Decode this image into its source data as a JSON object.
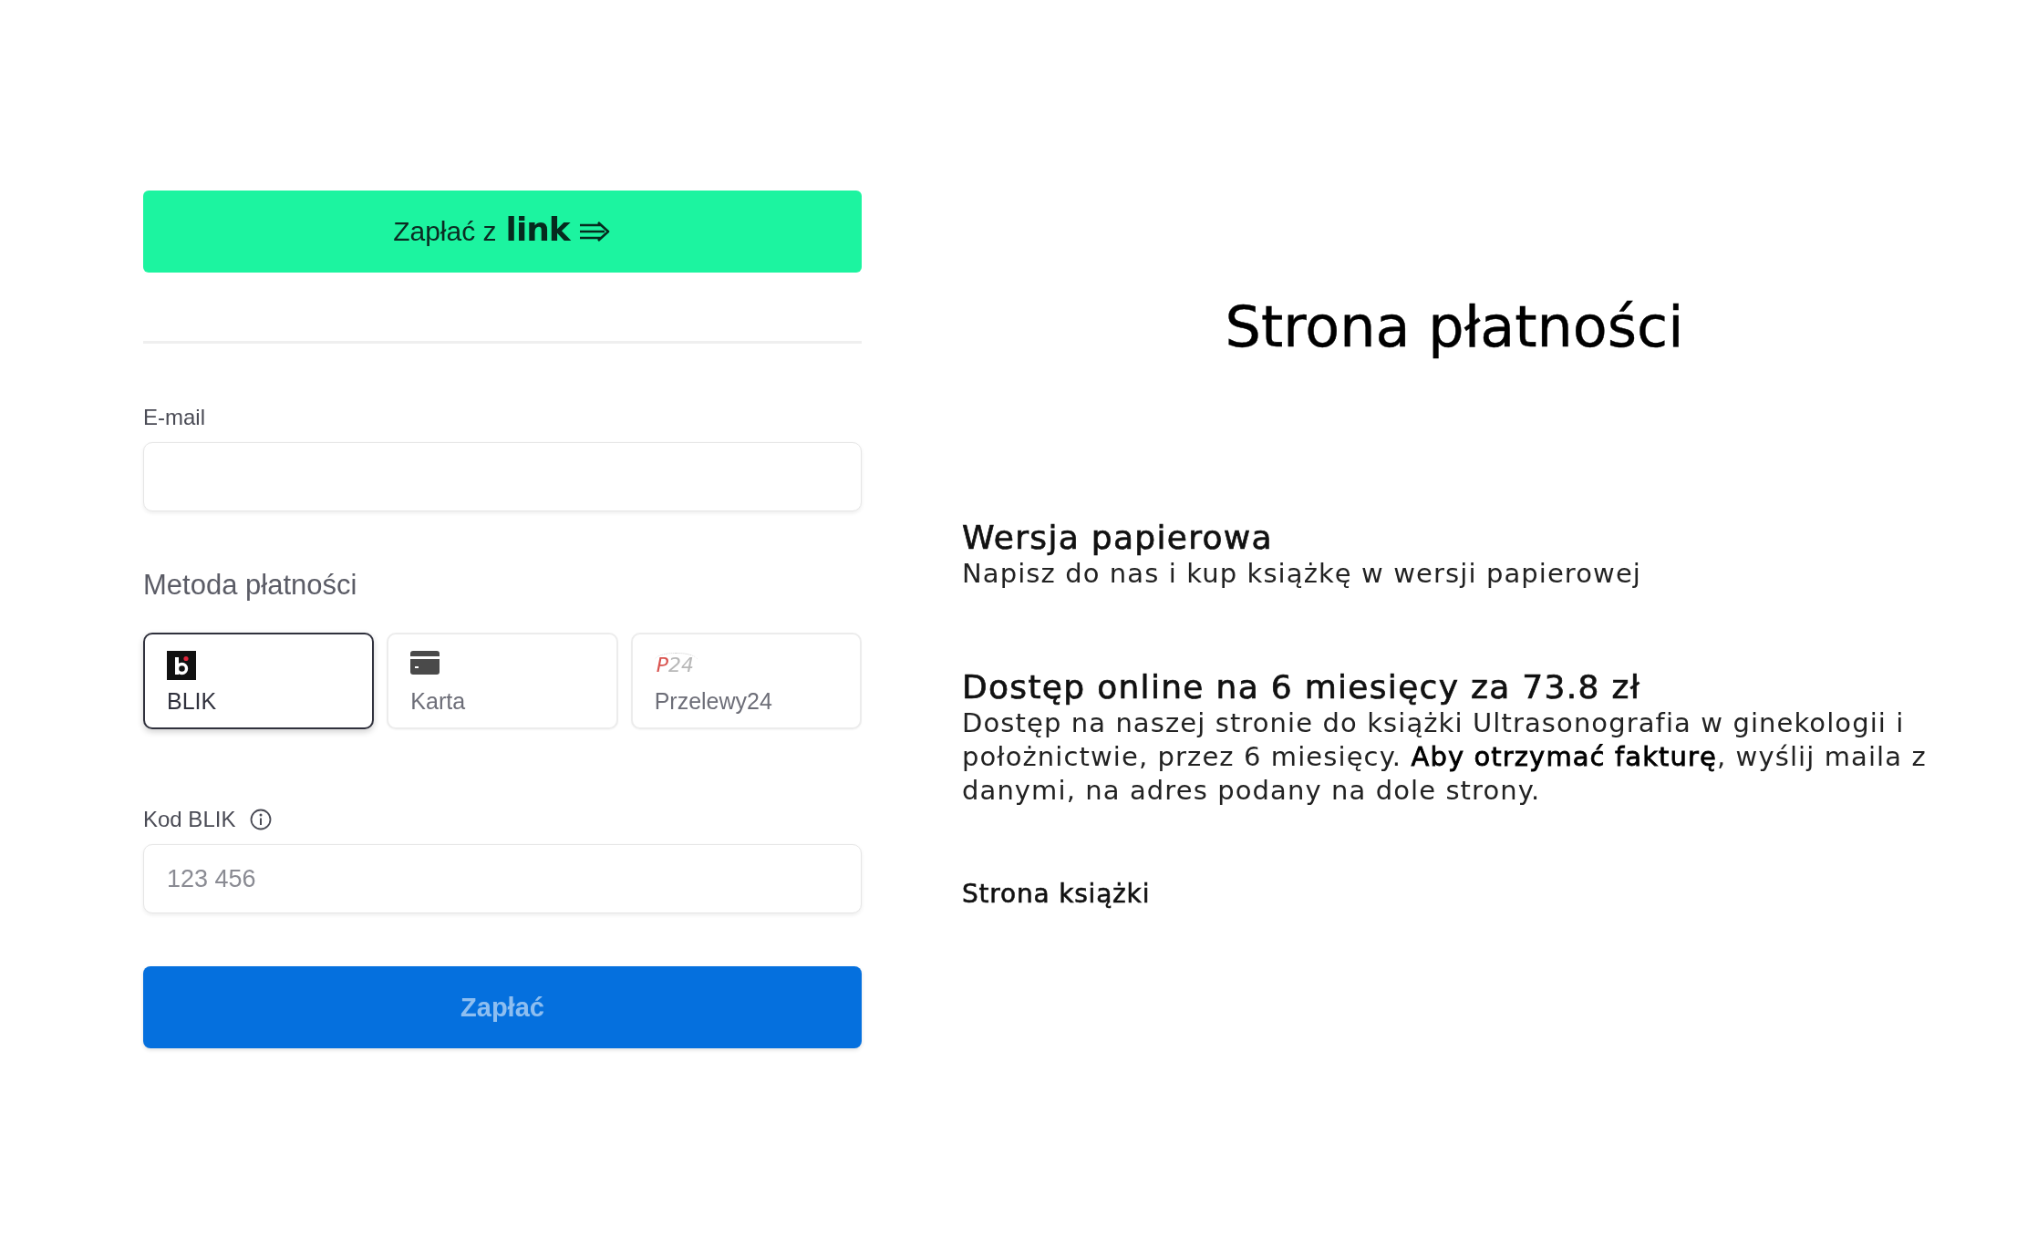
{
  "link_button": {
    "label": "Zapłać z",
    "logo": "link"
  },
  "email": {
    "label": "E-mail"
  },
  "payment_method": {
    "heading": "Metoda płatności",
    "options": [
      {
        "kind": "blik",
        "label": "BLIK",
        "selected": true
      },
      {
        "kind": "card",
        "label": "Karta",
        "selected": false
      },
      {
        "kind": "p24",
        "label": "Przelewy24",
        "logo": "P24",
        "selected": false
      }
    ]
  },
  "blik_code": {
    "label": "Kod BLIK",
    "placeholder": "123 456"
  },
  "pay_button": {
    "label": "Zapłać",
    "disabled": true
  },
  "page_title": "Strona płatności",
  "offers": [
    {
      "title": "Wersja papierowa",
      "description": "Napisz do nas i kup książkę w wersji papierowej"
    },
    {
      "title": "Dostęp online na 6 miesięcy za 73.8 zł",
      "description": "Dostęp na naszej stronie do książki Ultrasonografia w ginekologii i położnictwie, przez 6 miesięcy. **Aby otrzymać fakturę**, wyślij maila z danymi, na adres podany na dole strony."
    }
  ],
  "book_link": "Strona książki"
}
